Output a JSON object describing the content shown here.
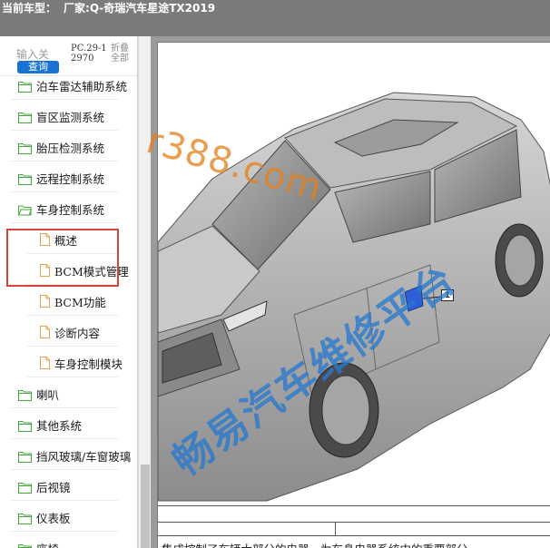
{
  "header": {
    "vehicle_label": "当前车型：",
    "vehicle_value": "厂家:Q-奇瑞汽车星途TX2019"
  },
  "sidebar": {
    "search_placeholder": "输入关",
    "query_button": "查询",
    "pc_code": "PC.29-12970",
    "fold_all": "折叠全部",
    "items": [
      {
        "label": "泊车雷达辅助系统",
        "type": "folder"
      },
      {
        "label": "盲区监测系统",
        "type": "folder"
      },
      {
        "label": "胎压检测系统",
        "type": "folder"
      },
      {
        "label": "远程控制系统",
        "type": "folder"
      },
      {
        "label": "车身控制系统",
        "type": "folder-open"
      },
      {
        "label": "概述",
        "type": "doc"
      },
      {
        "label": "BCM模式管理",
        "type": "doc"
      },
      {
        "label": "BCM功能",
        "type": "doc"
      },
      {
        "label": "诊断内容",
        "type": "doc"
      },
      {
        "label": "车身控制模块",
        "type": "doc"
      },
      {
        "label": "喇叭",
        "type": "folder"
      },
      {
        "label": "其他系统",
        "type": "folder"
      },
      {
        "label": "挡风玻璃/车窗玻璃",
        "type": "folder"
      },
      {
        "label": "后视镜",
        "type": "folder"
      },
      {
        "label": "仪表板",
        "type": "folder"
      },
      {
        "label": "座椅",
        "type": "folder"
      }
    ]
  },
  "viewer": {
    "callout_number": "1",
    "caption": "集成控制了车辆大部分的电器，为车身电器系统中的重要部分",
    "watermark_url": "r388.com",
    "watermark_cn": "畅易汽车维修平台"
  },
  "colors": {
    "topbar": "#7b7b7b",
    "folder": "#44a83c",
    "doc": "#e5a24a",
    "highlight": "#d9443a",
    "query_button": "#1a73d4",
    "watermark_orange": "#e5801c",
    "watermark_blue": "#2878cd"
  }
}
